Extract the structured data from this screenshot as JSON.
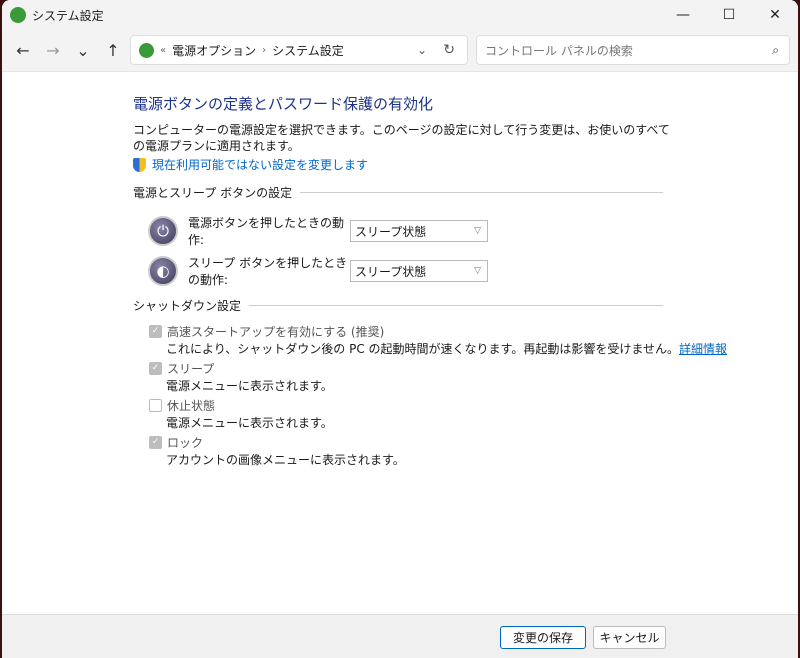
{
  "window": {
    "title": "システム設定",
    "minimize": "—",
    "maximize": "☐",
    "close": "✕"
  },
  "nav": {
    "back": "←",
    "forward": "→",
    "recent": "⌄",
    "up": "↑",
    "breadcrumb": [
      "電源オプション",
      "システム設定"
    ],
    "crumb_prefix": "«",
    "separator": "›",
    "dropdown": "⌄",
    "refresh": "↻"
  },
  "search": {
    "placeholder": "コントロール パネルの検索",
    "icon": "⌕"
  },
  "main": {
    "title": "電源ボタンの定義とパスワード保護の有効化",
    "description": "コンピューターの電源設定を選択できます。このページの設定に対して行う変更は、お使いのすべての電源プランに適用されます。",
    "admin_link": "現在利用可能ではない設定を変更します",
    "power_section": "電源とスリープ ボタンの設定",
    "power_button_label": "電源ボタンを押したときの動作:",
    "power_button_value": "スリープ状態",
    "sleep_button_label": "スリープ ボタンを押したときの動作:",
    "sleep_button_value": "スリープ状態",
    "shutdown_section": "シャットダウン設定",
    "options": [
      {
        "label": "高速スタートアップを有効にする (推奨)",
        "desc": "これにより、シャットダウン後の PC の起動時間が速くなります。再起動は影響を受けません。",
        "link": "詳細情報",
        "checked": true
      },
      {
        "label": "スリープ",
        "desc": "電源メニューに表示されます。",
        "checked": true
      },
      {
        "label": "休止状態",
        "desc": "電源メニューに表示されます。",
        "checked": false
      },
      {
        "label": "ロック",
        "desc": "アカウントの画像メニューに表示されます。",
        "checked": true
      }
    ]
  },
  "footer": {
    "save": "変更の保存",
    "cancel": "キャンセル"
  }
}
